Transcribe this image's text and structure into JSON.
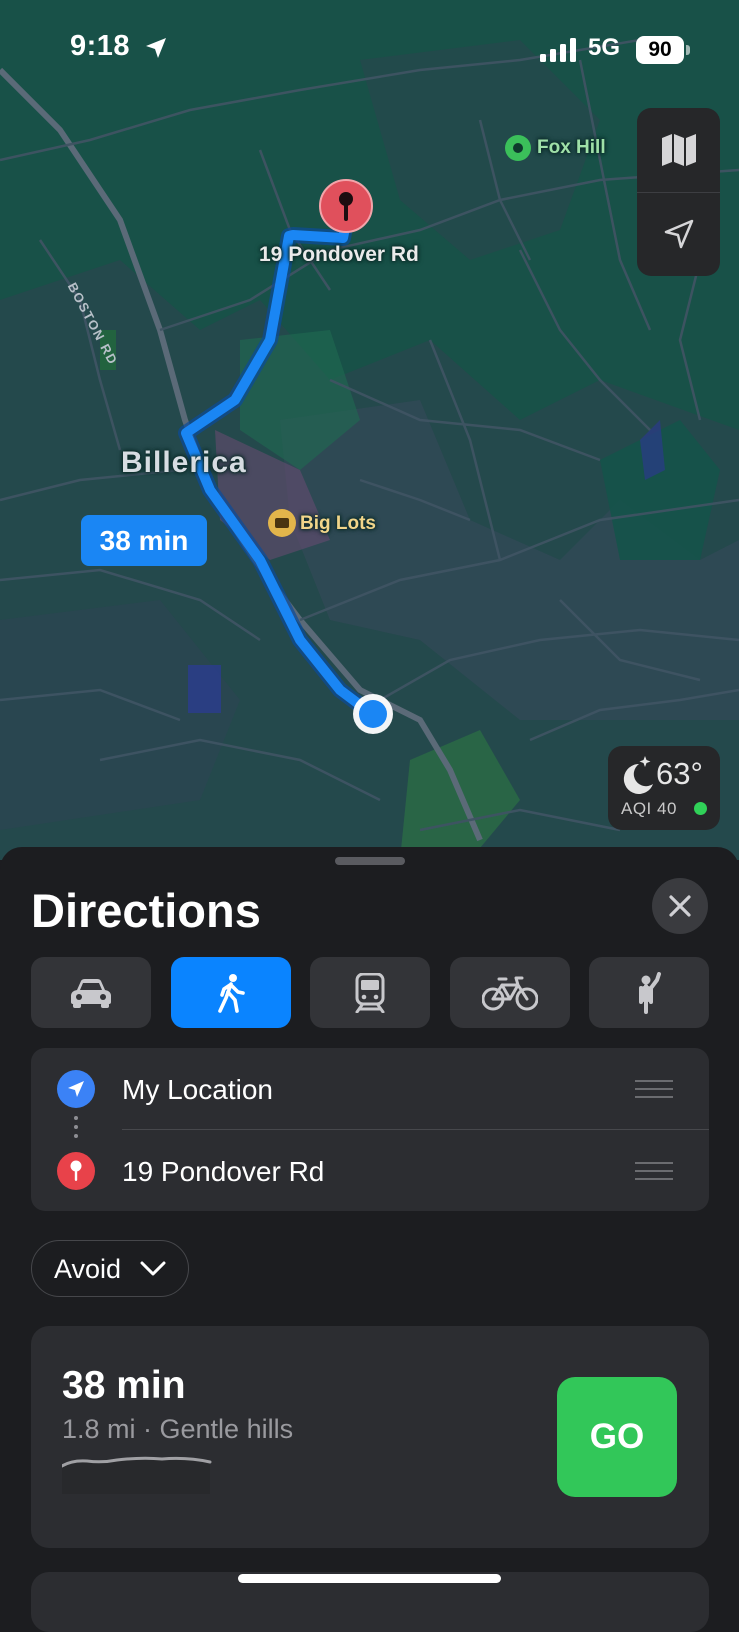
{
  "status_bar": {
    "time": "9:18",
    "network": "5G",
    "battery": "90"
  },
  "map": {
    "labels": {
      "fox_hill": "Fox Hill",
      "destination": "19 Pondover Rd",
      "town": "Billerica",
      "road": "BOSTON RD",
      "store": "Big Lots"
    },
    "route_badge": "38 min",
    "weather": {
      "temp": "63°",
      "aqi": "AQI 40"
    },
    "icons": [
      "map-icon",
      "location-arrow-icon",
      "moon-icon",
      "pin-icon"
    ]
  },
  "sheet": {
    "title": "Directions",
    "modes": [
      {
        "name": "drive",
        "icon": "car-icon"
      },
      {
        "name": "walk",
        "icon": "walk-icon",
        "active": true
      },
      {
        "name": "transit",
        "icon": "train-icon"
      },
      {
        "name": "cycle",
        "icon": "bike-icon"
      },
      {
        "name": "rideshare",
        "icon": "hail-icon"
      }
    ],
    "from": "My Location",
    "to": "19 Pondover Rd",
    "avoid_label": "Avoid",
    "route": {
      "time": "38 min",
      "details": "1.8 mi · Gentle hills",
      "go_label": "GO"
    }
  },
  "colors": {
    "accent": "#0a84ff",
    "go": "#32c759",
    "route": "#1a86f4",
    "pin": "#e0505c"
  }
}
